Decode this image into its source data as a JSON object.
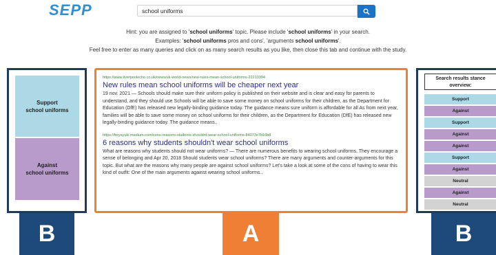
{
  "header": {
    "logo": "SEPP",
    "search": {
      "value": "school uniforms",
      "button_icon": "search-icon"
    }
  },
  "hint": {
    "line1_pre": "Hint: you are assigned to '",
    "line1_topic": "school uniforms",
    "line1_mid": "' topic. Please include '",
    "line1_topic2": "school uniforms",
    "line1_post": "' in your search.",
    "line2_pre": "Examples: '",
    "line2_topic": "school uniforms",
    "line2_mid": " pros and cons', 'arguments ",
    "line2_topic2": "school uniforms",
    "line2_post": "'.",
    "line3": "Feel free to enter as many queries and click on as many search results as you like, then close this tab and continue with the study."
  },
  "left_panel": {
    "support": {
      "line1": "Support",
      "line2": "school uniforms"
    },
    "against": {
      "line1": "Against",
      "line2": "school uniforms"
    }
  },
  "results": [
    {
      "url": "https://www.liverpoolecho.co.uk/news/uk-world-news/new-rules-mean-school-uniforms-22219394",
      "title": "New rules mean school uniforms will be cheaper next year",
      "snippet": "19 nov. 2021 — Schools should make sure their uniform policy is published on their website and is clear and easy for parents to understand, and they should use Schools will be able to save some money on school uniforms for their children, as the Department for Education (DfE) has released new legally-binding guidance today. The guidance means sure uniform is affordable for all As from next year, families will be able to save some money on school uniforms for their children, as the Department for Education (DfE) has released new legally-binding guidance today. The guidance means.."
    },
    {
      "url": "https://freyayuki.medium.com/cons-reasons-students-shouldnt-wear-school-uniforms-84073e7b16b8",
      "title": "6 reasons why students shouldn't wear school uniforms",
      "snippet": "What are reasons why students should not wear uniforms? — There are numerous benefits to wearing school uniforms. They encourage a sense of belonging and Apr 20, 2018 Should students wear school uniforms? There are many arguments and counter-arguments for this topic. But what are the reasons why many people are against school uniforms? Let's take a look at some of the cons of having to wear this kind of outfit: One of the main arguments against wearing school uniforms.."
    }
  ],
  "overview": {
    "title_line1": "Search results stance",
    "title_line2": "overview:",
    "rows": [
      "Support",
      "Against",
      "Support",
      "Against",
      "Against",
      "Support",
      "Against",
      "Neutral",
      "Against",
      "Neutral"
    ]
  },
  "labels": {
    "left": "B",
    "middle": "A",
    "right": "B"
  },
  "colors": {
    "support": "#add8e6",
    "against": "#b89acb",
    "neutral": "#d3d3d3",
    "panel_border": "#1d3a5c",
    "results_border": "#ef7f34",
    "label_blue": "#1d4a7a",
    "label_orange": "#ef7f34"
  }
}
